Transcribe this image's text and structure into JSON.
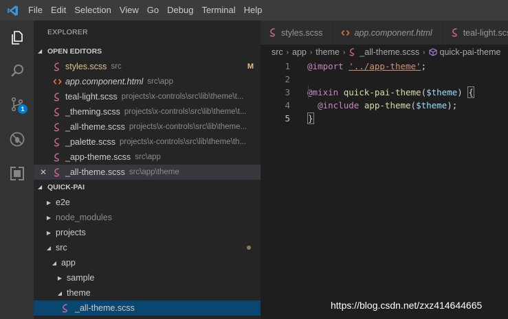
{
  "menu": {
    "items": [
      "File",
      "Edit",
      "Selection",
      "View",
      "Go",
      "Debug",
      "Terminal",
      "Help"
    ]
  },
  "activity_bar": {
    "items": [
      "files-icon",
      "search-icon",
      "source-control-icon",
      "debug-icon",
      "extensions-icon"
    ],
    "scm_badge": "1"
  },
  "sidebar": {
    "title": "EXPLORER",
    "open_editors": {
      "header": "OPEN EDITORS",
      "items": [
        {
          "name": "styles.scss",
          "path": "src",
          "status": "M"
        },
        {
          "name": "app.component.html",
          "path": "src\\app"
        },
        {
          "name": "teal-light.scss",
          "path": "projects\\x-controls\\src\\lib\\theme\\t..."
        },
        {
          "name": "_theming.scss",
          "path": "projects\\x-controls\\src\\lib\\theme\\t..."
        },
        {
          "name": "_all-theme.scss",
          "path": "projects\\x-controls\\src\\lib\\theme..."
        },
        {
          "name": "_palette.scss",
          "path": "projects\\x-controls\\src\\lib\\theme\\th..."
        },
        {
          "name": "_app-theme.scss",
          "path": "src\\app"
        },
        {
          "name": "_all-theme.scss",
          "path": "src\\app\\theme",
          "close": "✕"
        }
      ]
    },
    "project": {
      "header": "QUICK-PAI",
      "items": [
        "e2e",
        "node_modules",
        "projects",
        "src",
        "app",
        "sample",
        "theme",
        "_all-theme.scss"
      ]
    }
  },
  "editor": {
    "tabs": [
      {
        "label": "styles.scss"
      },
      {
        "label": "app.component.html"
      },
      {
        "label": "teal-light.scss"
      }
    ],
    "breadcrumb": [
      "src",
      "app",
      "theme",
      "_all-theme.scss",
      "quick-pai-theme"
    ],
    "line_numbers": [
      "1",
      "2",
      "3",
      "4",
      "5"
    ],
    "code": {
      "l1_kw": "@import",
      "l1_str": "'../app-theme'",
      "l1_end": ";",
      "l3_kw": "@mixin",
      "l3_fn": "quick-pai-theme",
      "l3_open": "(",
      "l3_var": "$theme",
      "l3_close": ") ",
      "l3_brace": "{",
      "l4_kw": "@include",
      "l4_fn": "app-theme",
      "l4_open": "(",
      "l4_var": "$theme",
      "l4_close": ");",
      "l5_brace": "}"
    }
  },
  "watermark": "https://blog.csdn.net/zxz414644665",
  "colors": {
    "accent": "#007acc",
    "selection": "#094771",
    "modified": "#e2c08d",
    "scss_icon": "#cd6799",
    "html_icon": "#e37933"
  }
}
